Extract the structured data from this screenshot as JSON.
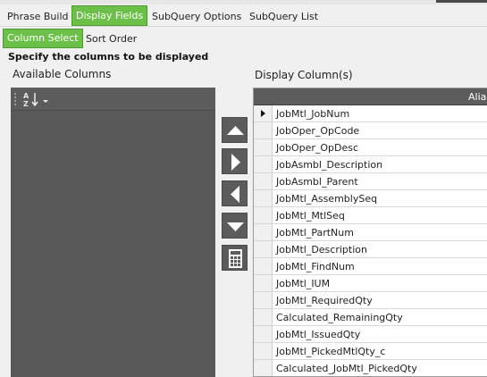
{
  "tabs_primary": [
    {
      "label": "Phrase Build",
      "active": false
    },
    {
      "label": "Display Fields",
      "active": true
    },
    {
      "label": "SubQuery Options",
      "active": false
    },
    {
      "label": "SubQuery List",
      "active": false
    }
  ],
  "tabs_secondary": [
    {
      "label": "Column Select",
      "active": true
    },
    {
      "label": "Sort Order",
      "active": false
    }
  ],
  "instruction": "Specify the columns to be displayed",
  "available_columns": {
    "label": "Available Columns",
    "sort_button_label": "A Z",
    "sort_icon": "sort-az-icon",
    "items": []
  },
  "move_buttons": [
    "move-up-icon",
    "move-right-icon",
    "move-left-icon",
    "move-down-icon",
    "calculator-icon"
  ],
  "display_columns": {
    "label": "Display Column(s)",
    "header": "Alias",
    "rows": [
      "JobMtl_JobNum",
      "JobOper_OpCode",
      "JobOper_OpDesc",
      "JobAsmbl_Description",
      "JobAsmbl_Parent",
      "JobMtl_AssemblySeq",
      "JobMtl_MtlSeq",
      "JobMtl_PartNum",
      "JobMtl_Description",
      "JobMtl_FindNum",
      "JobMtl_IUM",
      "JobMtl_RequiredQty",
      "Calculated_RemainingQty",
      "JobMtl_IssuedQty",
      "JobMtl_PickedMtlQty_c",
      "Calculated_JobMtl_PickedQty"
    ],
    "selected_row": 0
  },
  "colors": {
    "tab_active": "#6cc04a",
    "panel_dark": "#5c5c5c",
    "background": "#f0f0f0"
  }
}
